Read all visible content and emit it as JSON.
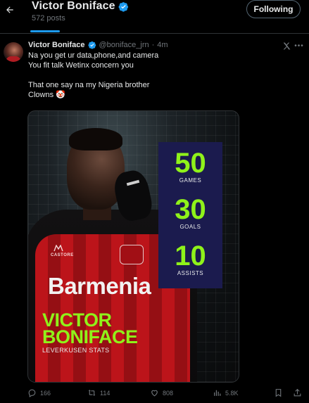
{
  "header": {
    "back_icon": "arrow-left-icon",
    "title": "Victor Boniface",
    "verified_icon": "verified-badge-icon",
    "posts_count": "572 posts",
    "following_label": "Following",
    "accent": "#1d9bf0"
  },
  "tweet": {
    "author_name": "Victor Boniface",
    "handle": "@boniface_jrn",
    "separator": "·",
    "time": "4m",
    "text": "Na you get ur data,phone,and camera\nYou fit talk Wetinx concern you\n\nThat one say na my Nigeria brother\nClowns 🤡",
    "media": {
      "stats": [
        {
          "value": "50",
          "label": "GAMES"
        },
        {
          "value": "30",
          "label": "GOALS"
        },
        {
          "value": "10",
          "label": "ASSISTS"
        }
      ],
      "player_first": "VICTOR",
      "player_last": "BONIFACE",
      "subtitle": "LEVERKUSEN STATS",
      "sponsor": "Barmenia",
      "kit_maker": "CASTORE",
      "accent_green": "#8ff21a",
      "panel_color": "#1b1b4e"
    }
  },
  "actions": {
    "replies": "166",
    "reposts": "114",
    "likes": "808",
    "views": "5.8K"
  }
}
